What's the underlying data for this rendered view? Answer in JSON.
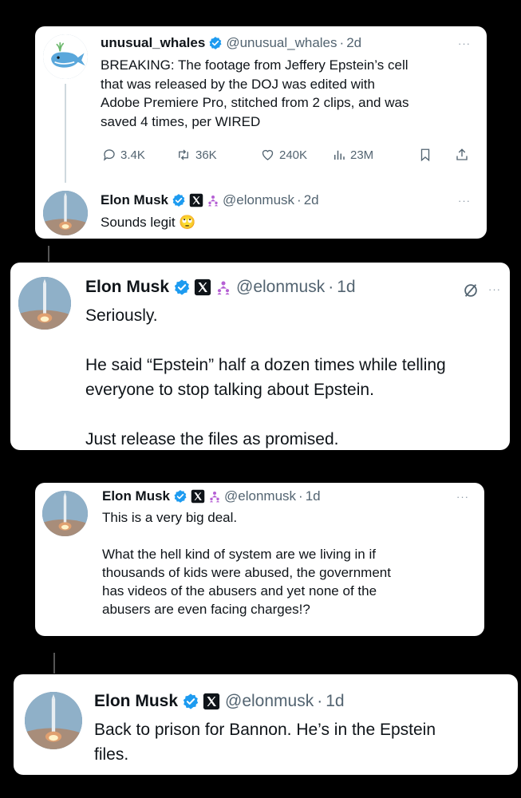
{
  "tweet1": {
    "name": "unusual_whales",
    "handle": "@unusual_whales",
    "time": "2d",
    "text": "BREAKING: The footage from Jeffery Epstein’s cell\nthat was released by the DOJ was edited with\nAdobe Premiere Pro, stitched from 2 clips, and was\nsaved 4 times, per WIRED",
    "replies": "3.4K",
    "retweets": "36K",
    "likes": "240K",
    "views": "23M"
  },
  "tweet2": {
    "name": "Elon Musk",
    "handle": "@elonmusk",
    "time": "2d",
    "text": "Sounds legit 🙄"
  },
  "tweet3": {
    "name": "Elon Musk",
    "handle": "@elonmusk",
    "time": "1d",
    "text": "Seriously.\n\nHe said “Epstein” half a dozen times while telling\neveryone to stop talking about Epstein.\n\nJust release the files as promised."
  },
  "tweet4": {
    "name": "Elon Musk",
    "handle": "@elonmusk",
    "time": "1d",
    "text": "This is a very big deal.\n\nWhat the hell kind of system are we living in if\nthousands of kids were abused, the government\nhas videos of the abusers and yet none of the\nabusers are even facing charges!?"
  },
  "tweet5": {
    "name": "Elon Musk",
    "handle": "@elonmusk",
    "time": "1d",
    "text": "Back to prison for Bannon. He’s in the Epstein\nfiles."
  },
  "separator": "·",
  "more": "···",
  "icons": [
    "verified-badge-icon",
    "x-logo-icon",
    "affiliate-icon",
    "reply-icon",
    "retweet-icon",
    "like-icon",
    "views-icon",
    "bookmark-icon",
    "share-icon",
    "edit-off-icon"
  ],
  "colors": {
    "verified": "#1d9bf0",
    "affiliate": "#b560d4",
    "muted": "#536471"
  }
}
